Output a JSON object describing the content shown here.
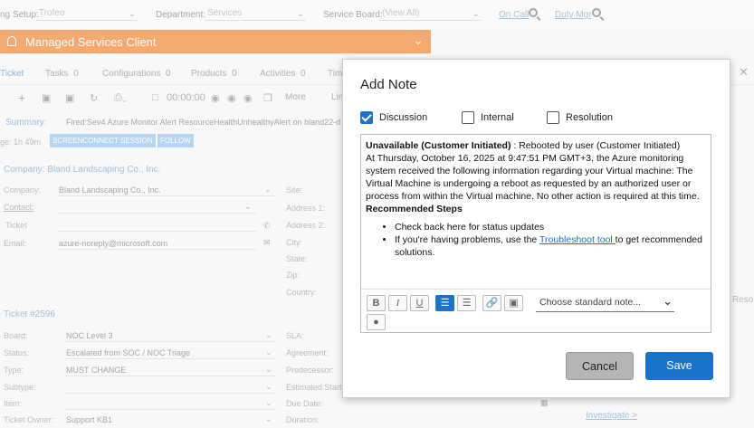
{
  "filters": {
    "setup_label": "ng Setup:",
    "setup_value": "Trofeo",
    "department_label": "Department:",
    "department_value": "Services",
    "service_board_label": "Service Board:",
    "service_board_value": "(View All)",
    "on_call": "On Call",
    "duty_mgr": "Duty Mgr"
  },
  "banner": {
    "title": "Managed Services Client"
  },
  "tabs": [
    {
      "label": "Ticket",
      "count": ""
    },
    {
      "label": "Tasks",
      "count": "0"
    },
    {
      "label": "Configurations",
      "count": "0"
    },
    {
      "label": "Products",
      "count": "0"
    },
    {
      "label": "Activities",
      "count": "0"
    },
    {
      "label": "Tim",
      "count": ""
    }
  ],
  "toolbar": {
    "timer": "00:00:00",
    "more": "More",
    "lin": "Lin"
  },
  "summary": {
    "label": "Summary:",
    "value": "Fired:Sev4 Azure Monitor Alert ResourceHealthUnhealthyAlert on bland22-d",
    "age": "ge: 1h 49m",
    "screenconnect": "SCREENCONNECT SESSION",
    "follow": "FOLLOW"
  },
  "company_section": {
    "title": "Company: Bland Landscaping Co., Inc.",
    "company_label": "Company:",
    "company_value": "Bland Landscaping Co., Inc.",
    "contact_label": "Contact:",
    "ticket_label": "Ticket",
    "email_label": "Email:",
    "email_value": "azure-noreply@microsoft.com",
    "site_label": "Site:",
    "address1_label": "Address 1:",
    "address2_label": "Address 2:",
    "city_label": "City:",
    "state_label": "State:",
    "zip_label": "Zip:",
    "country_label": "Country:"
  },
  "ticket_section": {
    "title": "Ticket #2596",
    "board_label": "Board:",
    "board_value": "NOC Level 3",
    "status_label": "Status:",
    "status_value": "Escalated from SOC / NOC Triage",
    "type_label": "Type:",
    "type_value": "MUST CHANGE",
    "subtype_label": "Subtype:",
    "item_label": "Item:",
    "owner_label": "Ticket Owner:",
    "owner_value": "Support KB1",
    "sla_label": "SLA:",
    "agreement_label": "Agreement:",
    "predecessor_label": "Predecessor:",
    "est_start_label": "Estimated Start",
    "due_label": "Due Date:",
    "duration_label": "Duration:",
    "investigate": "Investigate >",
    "resou": "Resou"
  },
  "dialog": {
    "title": "Add Note",
    "checkboxes": [
      {
        "label": "Discussion",
        "checked": true
      },
      {
        "label": "Internal",
        "checked": false
      },
      {
        "label": "Resolution",
        "checked": false
      }
    ],
    "note": {
      "heading_bold": "Unavailable (Customer Initiated)",
      "heading_rest": " : Rebooted by user (Customer Initiated)",
      "paragraph": "At Thursday, October 16, 2025 at 9:47:51 PM GMT+3, the Azure monitoring system received the following information regarding your Virtual machine: The Virtual Machine is undergoing a reboot as requested by an authorized user or process from within the Virtual machine. No other action is required at this time.",
      "steps_heading": "Recommended Steps",
      "bullet1": "Check back here for status updates",
      "bullet2_pre": "If you're having problems, use the ",
      "bullet2_link": "Troubleshoot tool ",
      "bullet2_post": "to get recommended solutions."
    },
    "editor_tools": {
      "bold": "B",
      "italic": "I",
      "underline": "U"
    },
    "standard_note_placeholder": "Choose standard note...",
    "cancel_label": "Cancel",
    "save_label": "Save"
  }
}
